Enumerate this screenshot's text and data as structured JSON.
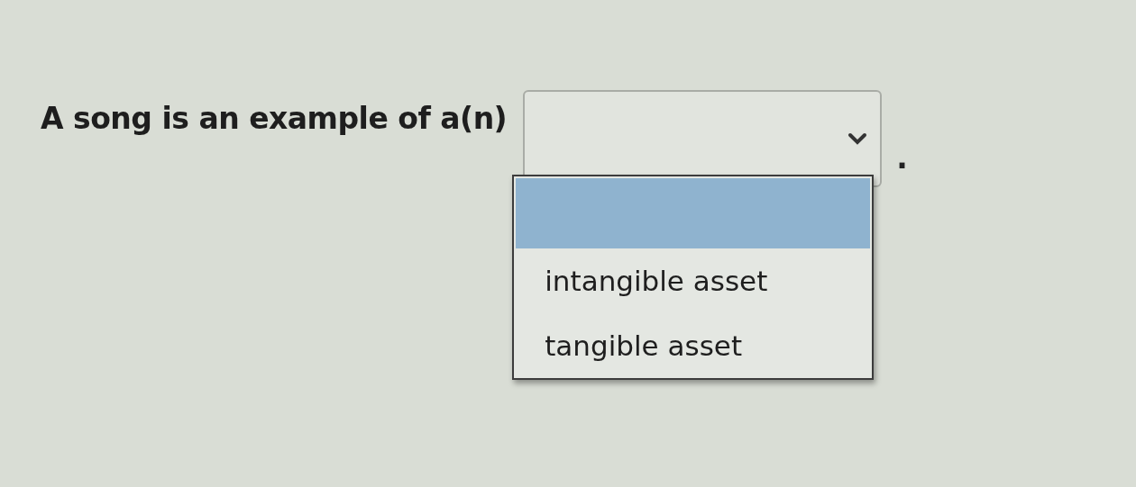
{
  "question": {
    "text": "A song is an example of a(n)",
    "suffix": "."
  },
  "select": {
    "expanded": true,
    "options": [
      {
        "kind": "blank",
        "selected": true
      },
      {
        "kind": "option",
        "label": "intangible asset",
        "selected": false
      },
      {
        "kind": "option",
        "label": "tangible asset",
        "selected": false
      }
    ]
  }
}
